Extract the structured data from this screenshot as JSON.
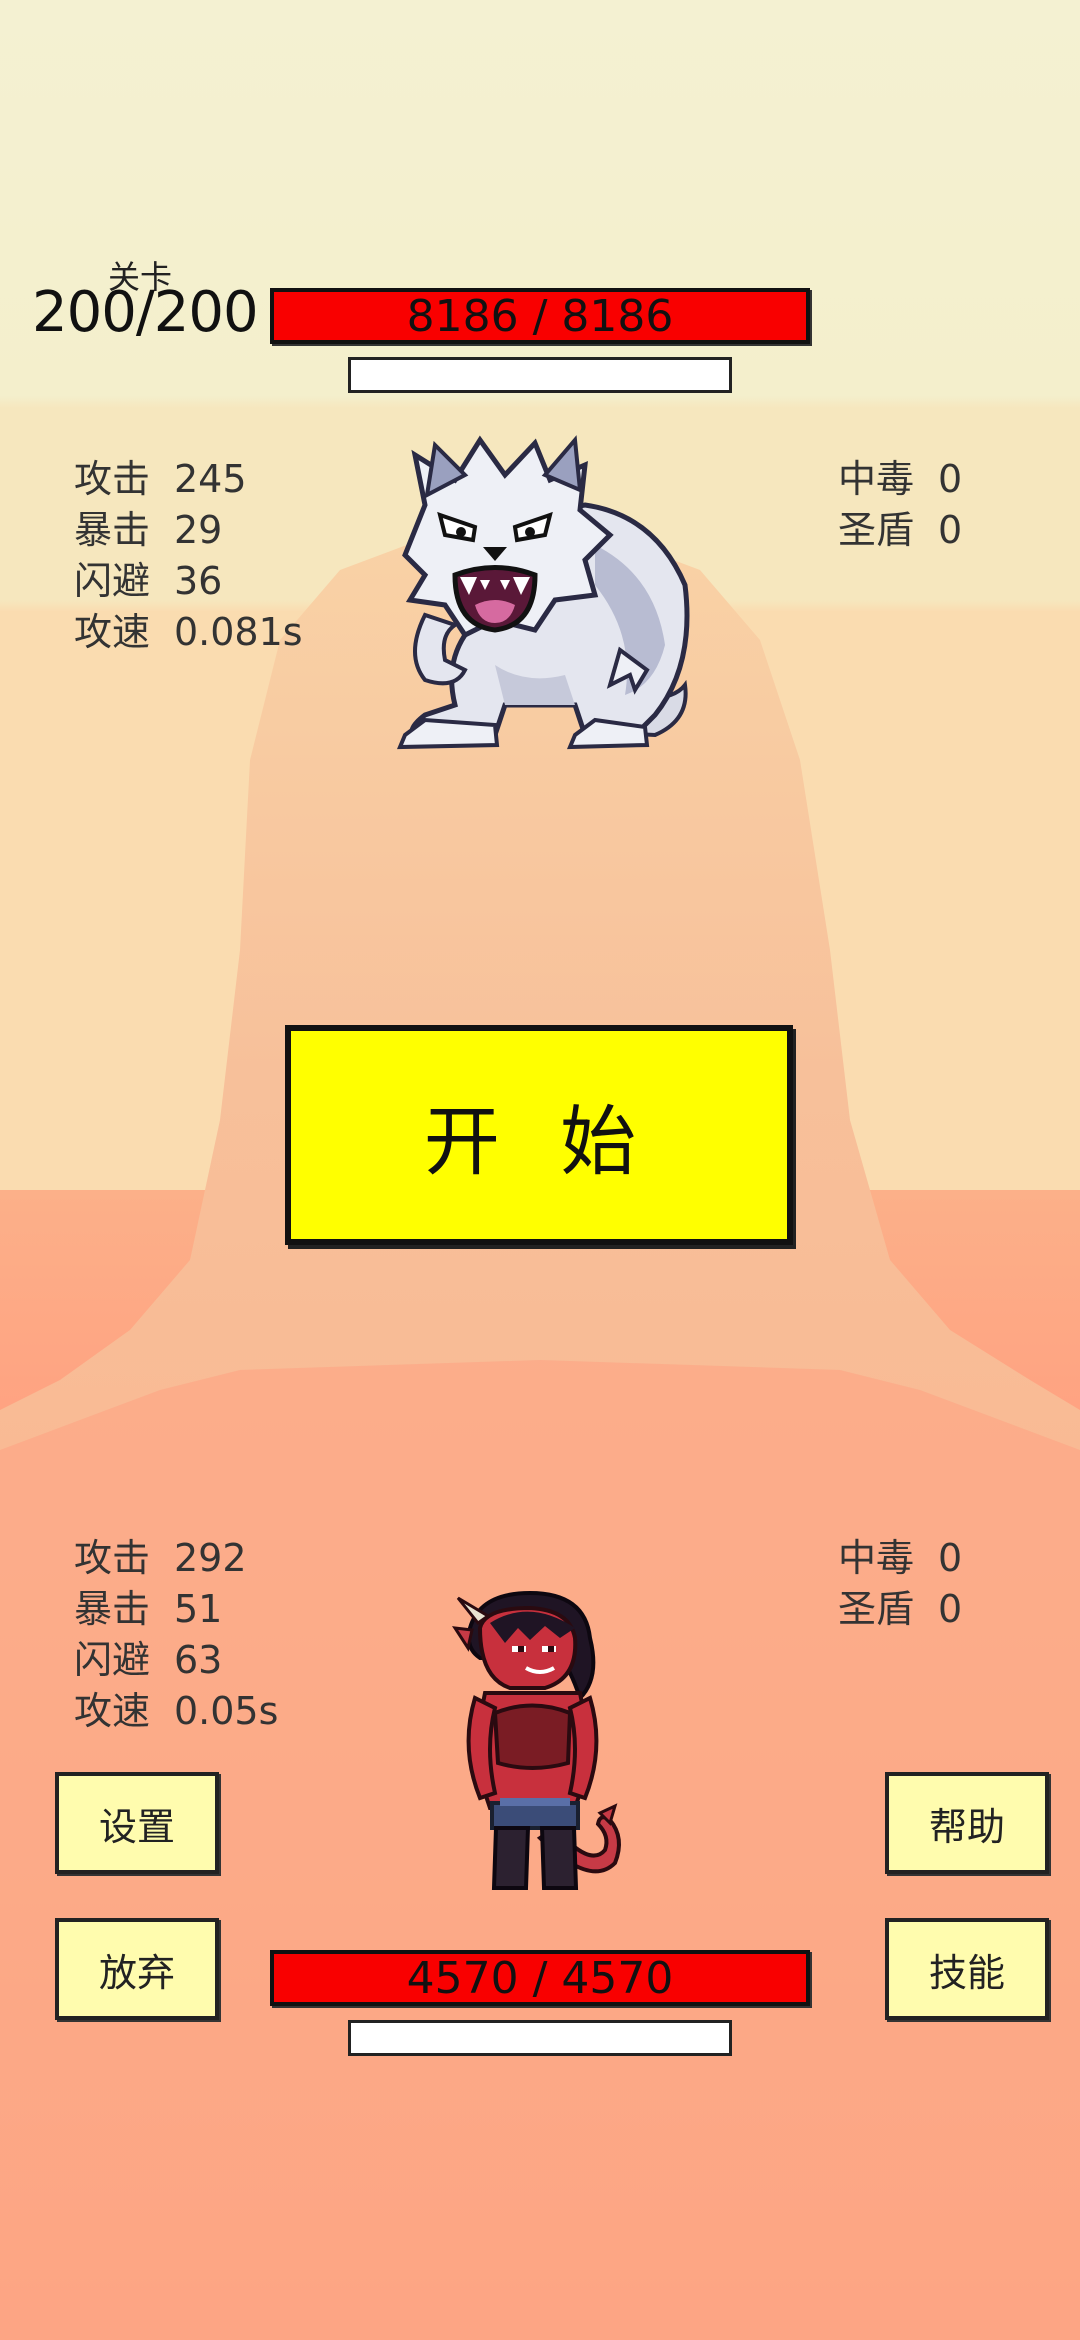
{
  "stage": {
    "caption": "关卡",
    "value": "200/200"
  },
  "enemy": {
    "hp_text": "8186 / 8186",
    "hp_fraction": 1.0,
    "sprite_icon": "werewolf-icon",
    "stats": [
      {
        "label": "攻击",
        "value": "245"
      },
      {
        "label": "暴击",
        "value": "29"
      },
      {
        "label": "闪避",
        "value": "36"
      },
      {
        "label": "攻速",
        "value": "0.081s"
      }
    ],
    "status": [
      {
        "label": "中毒",
        "value": "0"
      },
      {
        "label": "圣盾",
        "value": "0"
      }
    ]
  },
  "start_button": {
    "label": "开 始"
  },
  "player": {
    "hp_text": "4570 / 4570",
    "hp_fraction": 1.0,
    "sprite_icon": "demon-girl-icon",
    "stats": [
      {
        "label": "攻击",
        "value": "292"
      },
      {
        "label": "暴击",
        "value": "51"
      },
      {
        "label": "闪避",
        "value": "63"
      },
      {
        "label": "攻速",
        "value": "0.05s"
      }
    ],
    "status": [
      {
        "label": "中毒",
        "value": "0"
      },
      {
        "label": "圣盾",
        "value": "0"
      }
    ]
  },
  "buttons": {
    "settings": "设置",
    "help": "帮助",
    "give_up": "放弃",
    "skills": "技能"
  },
  "colors": {
    "hp_bar": "#f90000",
    "start_button": "#ffff00",
    "side_button": "#fffcae",
    "sky": "#f4f1d2",
    "ground": "#ff977a"
  }
}
